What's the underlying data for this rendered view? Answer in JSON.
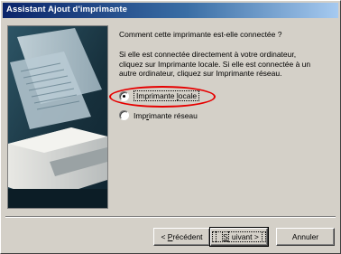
{
  "window": {
    "title": "Assistant Ajout d'imprimante"
  },
  "question": "Comment cette imprimante est-elle connectée ?",
  "description": [
    "Si elle est connectée directement à votre ordinateur,",
    "cliquez sur Imprimante locale. Si elle est connectée à un",
    "autre ordinateur, cliquez sur Imprimante réseau."
  ],
  "options": [
    {
      "pre": "Imprimante ",
      "accel": "l",
      "post": "ocale",
      "selected": true
    },
    {
      "pre": "Imp",
      "accel": "r",
      "post": "imante réseau",
      "selected": false
    }
  ],
  "buttons": {
    "back": {
      "pre": "< ",
      "accel": "P",
      "post": "récédent"
    },
    "next": {
      "pre": "",
      "accel": "S",
      "post": "uivant >"
    },
    "cancel": {
      "label": "Annuler"
    }
  },
  "colors": {
    "titlebar_start": "#0a246a",
    "titlebar_end": "#a6caf0",
    "highlight_oval": "#e60000"
  },
  "icons": {
    "illustration": "printer-illustration"
  }
}
